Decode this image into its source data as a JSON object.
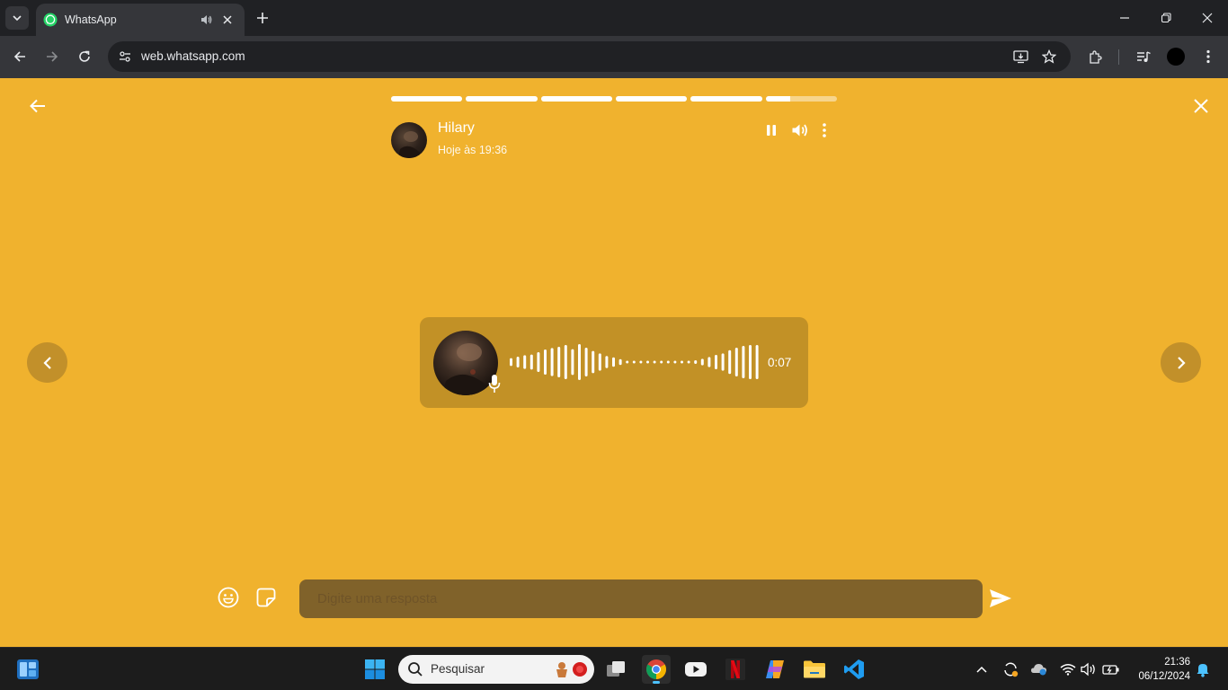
{
  "browser": {
    "tab": {
      "title": "WhatsApp",
      "favicon": "whatsapp-icon",
      "audio_icon": "speaker-icon",
      "close_icon": "close-icon"
    },
    "address": {
      "url": "web.whatsapp.com"
    }
  },
  "status_viewer": {
    "contact_name": "Hilary",
    "timestamp": "Hoje às 19:36",
    "progress": [
      1,
      1,
      1,
      1,
      1,
      0.35
    ],
    "voice_note": {
      "duration": "0:07",
      "waveform": [
        0.22,
        0.3,
        0.38,
        0.42,
        0.55,
        0.7,
        0.78,
        0.85,
        0.95,
        0.72,
        1.0,
        0.8,
        0.62,
        0.48,
        0.34,
        0.26,
        0.16,
        0.05,
        0.05,
        0.05,
        0.05,
        0.05,
        0.05,
        0.05,
        0.05,
        0.05,
        0.05,
        0.1,
        0.18,
        0.28,
        0.4,
        0.48,
        0.66,
        0.8,
        0.9,
        0.95,
        0.95
      ]
    },
    "reply": {
      "placeholder": "Digite uma resposta"
    },
    "colors": {
      "background": "#f0b22e",
      "card": "#c29126",
      "input": "#80622a"
    }
  },
  "taskbar": {
    "search_placeholder": "Pesquisar",
    "time": "21:36",
    "date": "06/12/2024"
  }
}
